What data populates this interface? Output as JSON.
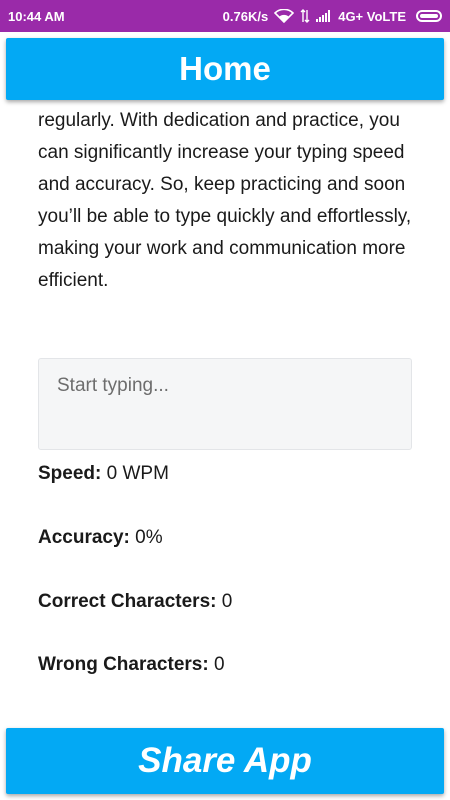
{
  "status_bar": {
    "time": "10:44 AM",
    "network_speed": "0.76K/s",
    "network_type": "4G+ VoLTE",
    "icons": [
      "wifi-icon",
      "data-transfer-icon",
      "signal-icon",
      "battery-icon"
    ]
  },
  "header": {
    "title": "Home"
  },
  "content": {
    "paragraph_visible": "regularly. With dedication and practice, you can significantly increase your typing speed and accuracy. So, keep practicing and soon you’ll be able to type quickly and effortlessly, making your work and communication more efficient."
  },
  "typing_input": {
    "placeholder": "Start typing...",
    "value": ""
  },
  "stats": {
    "speed": {
      "label": "Speed:",
      "value": "0 WPM"
    },
    "accuracy": {
      "label": "Accuracy:",
      "value": "0%"
    },
    "correct": {
      "label": "Correct Characters:",
      "value": "0"
    },
    "wrong": {
      "label": "Wrong Characters:",
      "value": "0"
    }
  },
  "share_button": {
    "label": "Share App"
  },
  "colors": {
    "status_bar": "#9a2aa9",
    "accent": "#03a9f4",
    "text": "#1a1a1a",
    "input_bg": "#f5f6f7"
  }
}
